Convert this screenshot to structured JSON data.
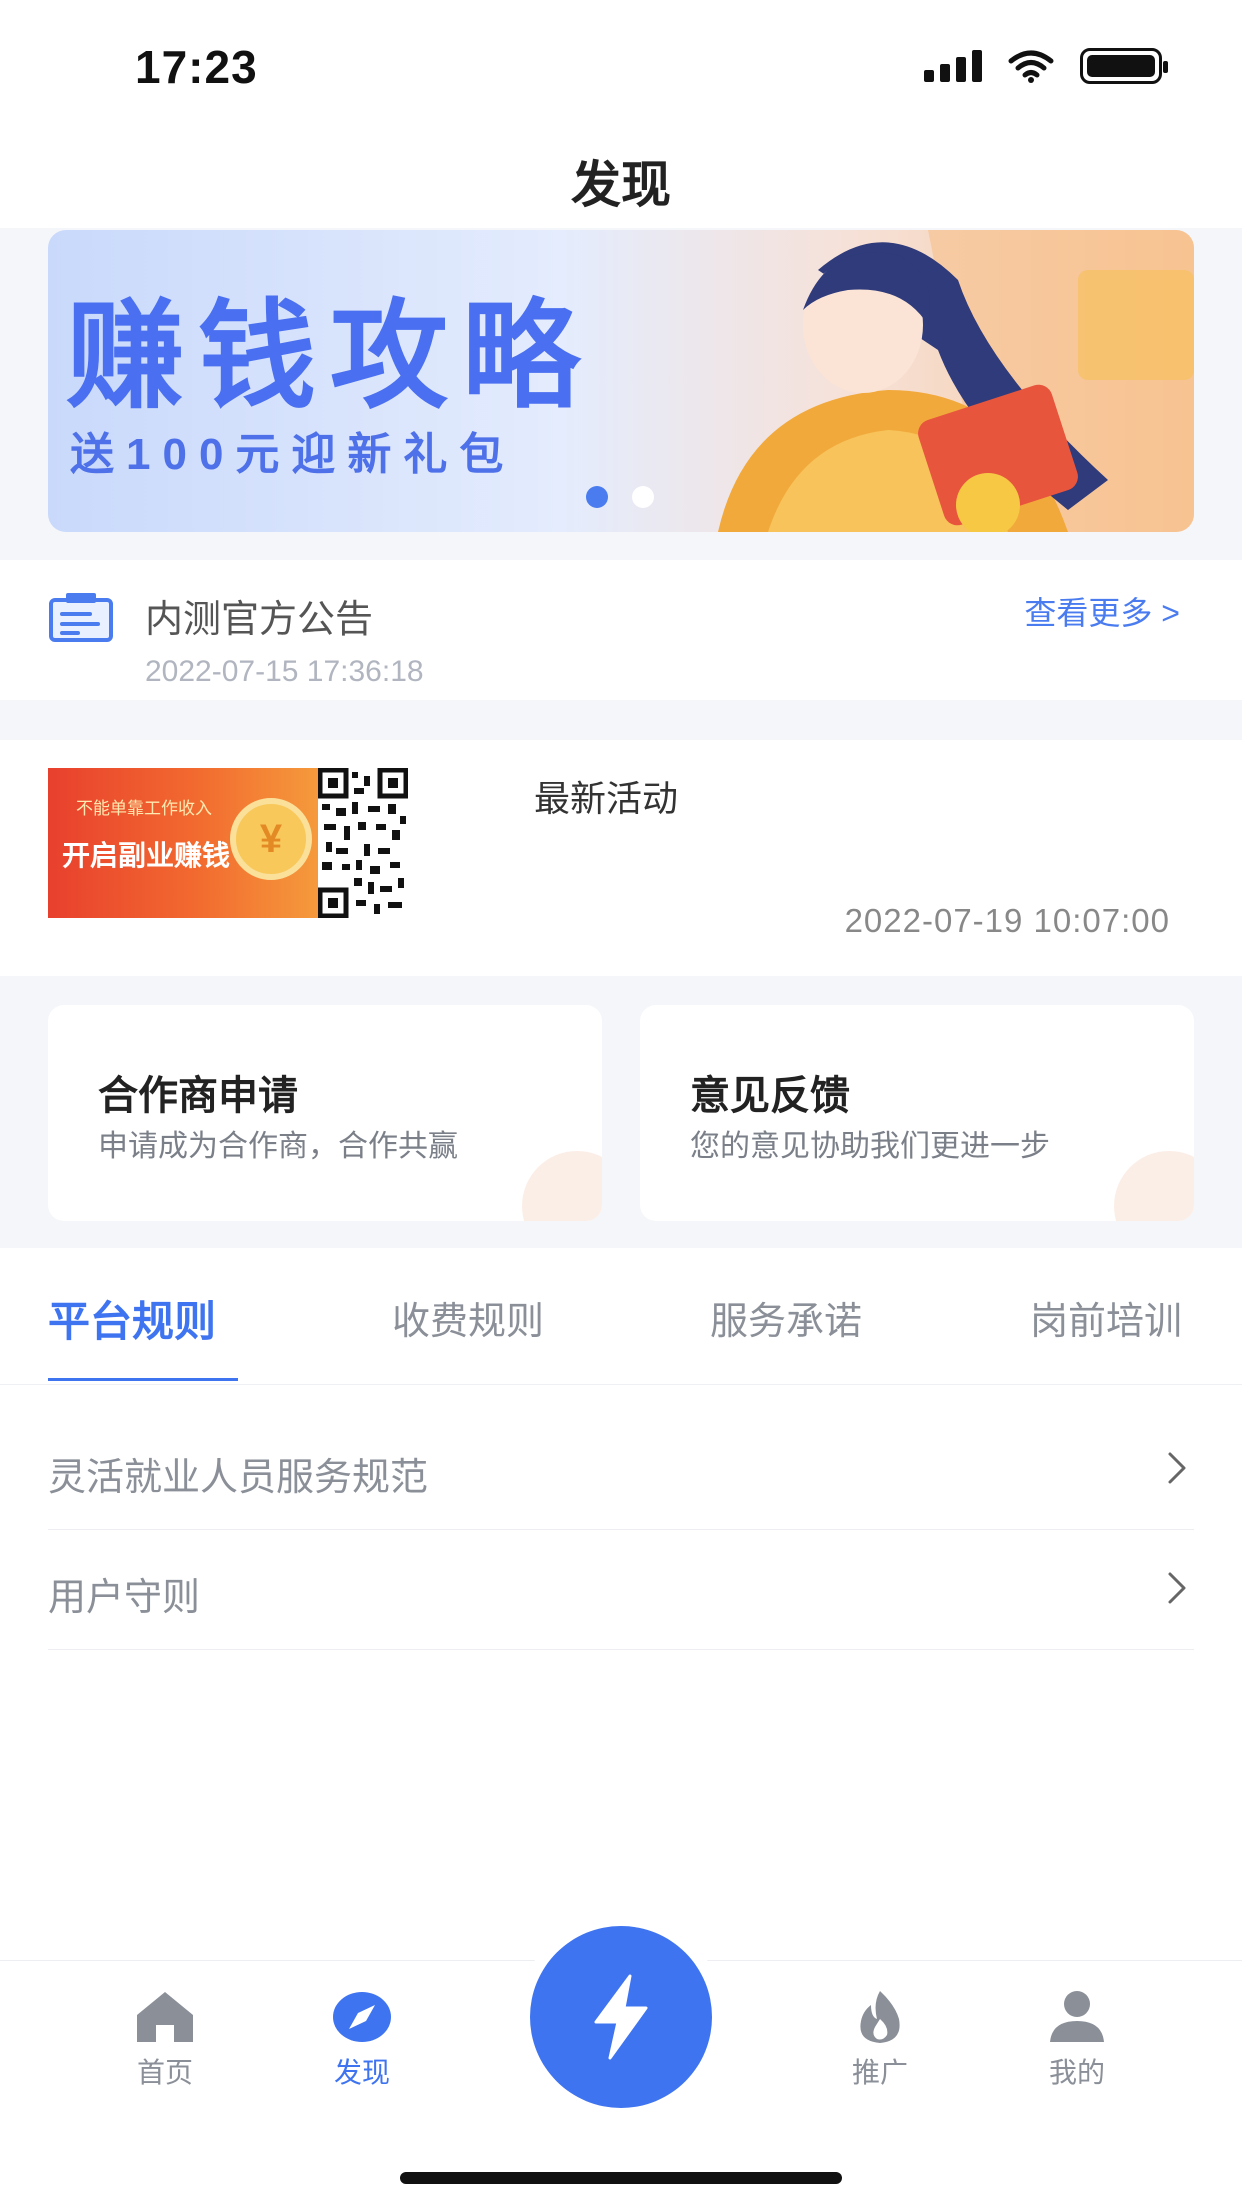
{
  "status_bar": {
    "time": "17:23"
  },
  "header": {
    "title": "发现"
  },
  "banner": {
    "title": "赚钱攻略",
    "subtitle": "送100元迎新礼包",
    "dots_count": 2,
    "active_dot": 1
  },
  "notice": {
    "title": "内测官方公告",
    "time": "2022-07-15 17:36:18",
    "more_label": "查看更多 >"
  },
  "activity": {
    "image_small_text": "不能单靠工作收入",
    "image_main_text": "开启副业赚钱",
    "image_coin_symbol": "¥",
    "title": "最新活动",
    "time": "2022-07-19 10:07:00"
  },
  "cards": [
    {
      "title": "合作商申请",
      "desc": "申请成为合作商，合作共赢"
    },
    {
      "title": "意见反馈",
      "desc": "您的意见协助我们更进一步"
    }
  ],
  "tabs": [
    {
      "label": "平台规则",
      "active": true
    },
    {
      "label": "收费规则",
      "active": false
    },
    {
      "label": "服务承诺",
      "active": false
    },
    {
      "label": "岗前培训",
      "active": false
    }
  ],
  "rules": [
    {
      "label": "灵活就业人员服务规范"
    },
    {
      "label": "用户守则"
    }
  ],
  "tabbar": {
    "items": [
      {
        "label": "首页",
        "icon": "home-icon",
        "active": false
      },
      {
        "label": "发现",
        "icon": "compass-icon",
        "active": true
      },
      {
        "label": "推广",
        "icon": "fire-icon",
        "active": false
      },
      {
        "label": "我的",
        "icon": "user-icon",
        "active": false
      }
    ],
    "center_icon": "lightning-icon"
  },
  "colors": {
    "accent": "#3f74f0",
    "page_bg": "#f4f6fa",
    "text_muted": "#8a8f98"
  }
}
